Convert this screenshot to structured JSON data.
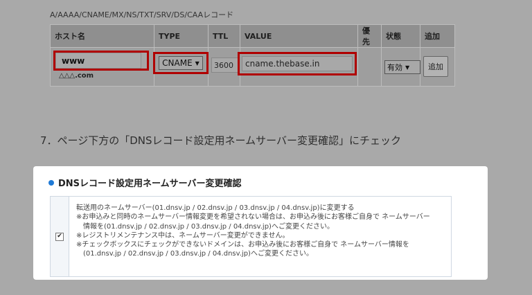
{
  "record_section": {
    "title": "A/AAAA/CNAME/MX/NS/TXT/SRV/DS/CAAレコード",
    "columns": [
      "ホスト名",
      "TYPE",
      "TTL",
      "VALUE",
      "優先",
      "状態",
      "追加"
    ],
    "row": {
      "host": "www",
      "domain_suffix": "△△△.com",
      "type": "CNAME",
      "ttl": "3600",
      "value": "cname.thebase.in",
      "priority": "",
      "status": "有効",
      "add_label": "追加"
    }
  },
  "step_text": "7．ページ下方の「DNSレコード設定用ネームサーバー変更確認」にチェック",
  "confirm": {
    "title": "DNSレコード設定用ネームサーバー変更確認",
    "checked": true,
    "check_glyph": "✔",
    "lines": [
      "転送用のネームサーバー(01.dnsv.jp / 02.dnsv.jp / 03.dnsv.jp / 04.dnsv.jp)に変更する",
      "※お申込みと同時のネームサーバー情報変更を希望されない場合は、お申込み後にお客様ご自身で ネームサーバー",
      "情報を(01.dnsv.jp / 02.dnsv.jp / 03.dnsv.jp / 04.dnsv.jp)へご変更ください。",
      "※レジストリメンテナンス中は、ネームサーバー変更ができません。",
      "※チェックボックスにチェックができないドメインは、お申込み後にお客様ご自身で ネームサーバー情報を",
      "(01.dnsv.jp / 02.dnsv.jp / 03.dnsv.jp / 04.dnsv.jp)へご変更ください。"
    ]
  },
  "colors": {
    "highlight": "#b00000",
    "accent_dot": "#1f7ad6"
  }
}
